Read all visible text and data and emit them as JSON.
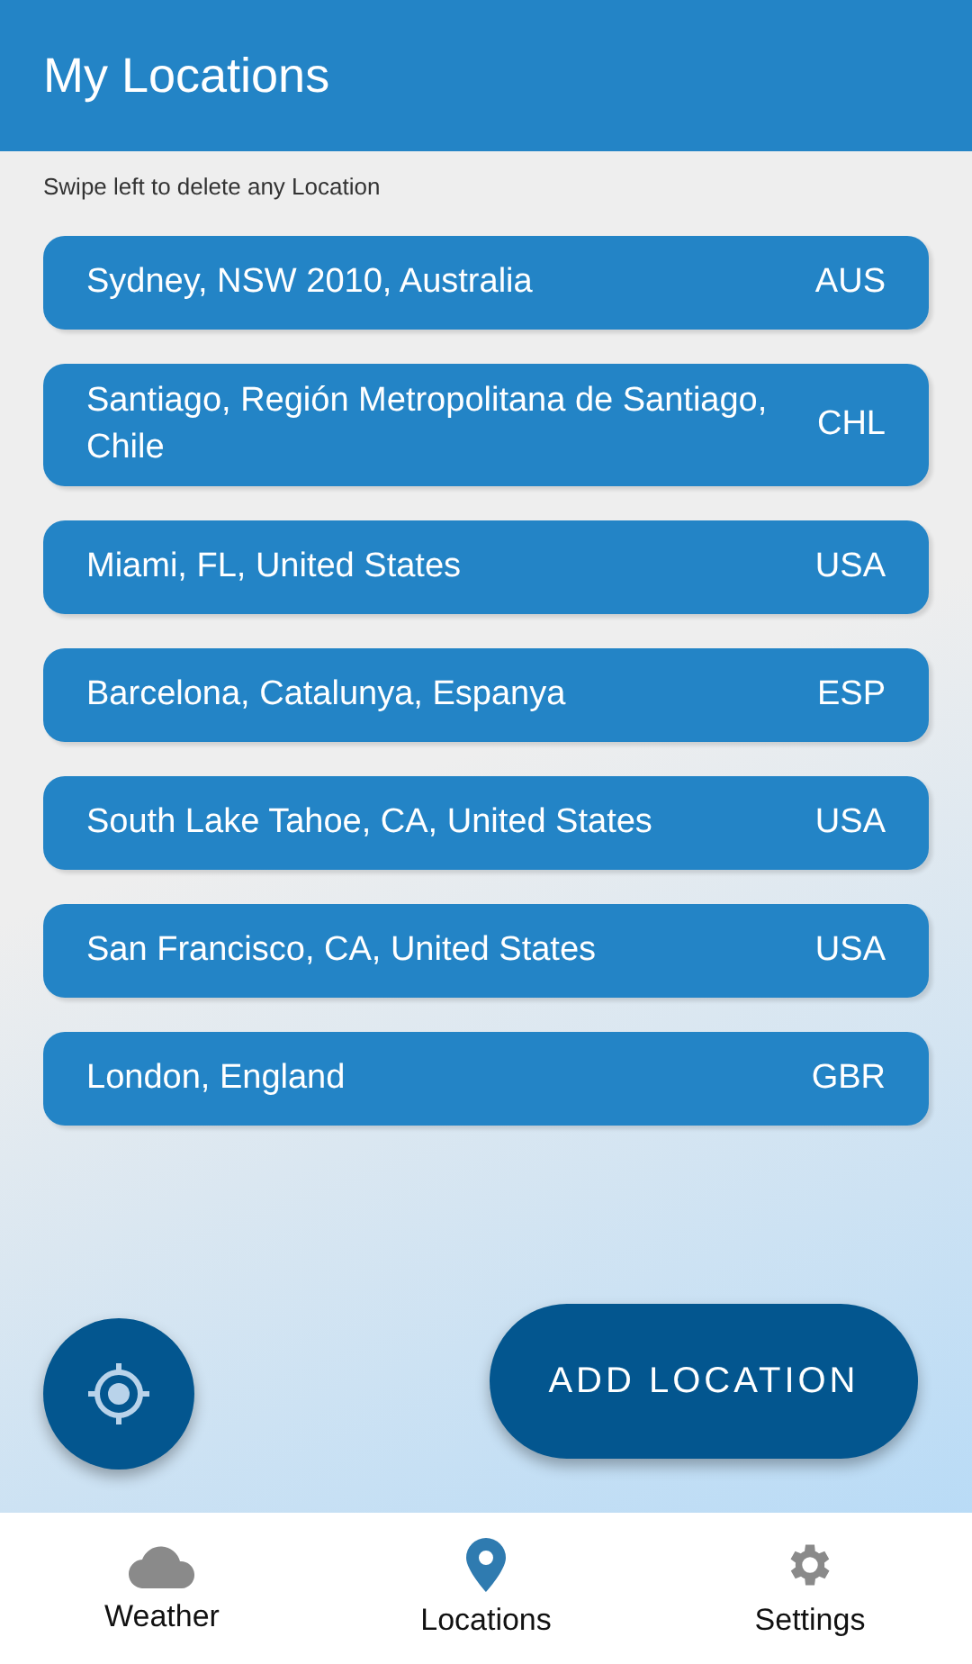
{
  "header": {
    "title": "My Locations"
  },
  "hint": "Swipe left to delete any Location",
  "locations": [
    {
      "name": "Sydney, NSW 2010, Australia",
      "code": "AUS"
    },
    {
      "name": "Santiago, Región Metropolitana de Santiago, Chile",
      "code": "CHL"
    },
    {
      "name": "Miami, FL, United States",
      "code": "USA"
    },
    {
      "name": "Barcelona, Catalunya, Espanya",
      "code": "ESP"
    },
    {
      "name": "South Lake Tahoe, CA, United States",
      "code": "USA"
    },
    {
      "name": "San Francisco, CA, United States",
      "code": "USA"
    },
    {
      "name": "London, England",
      "code": "GBR"
    }
  ],
  "add_button": "ADD LOCATION",
  "nav": [
    {
      "kind": "cloud",
      "label": "Weather",
      "selected": false
    },
    {
      "kind": "pin",
      "label": "Locations",
      "selected": true
    },
    {
      "kind": "gear",
      "label": "Settings",
      "selected": false
    }
  ]
}
